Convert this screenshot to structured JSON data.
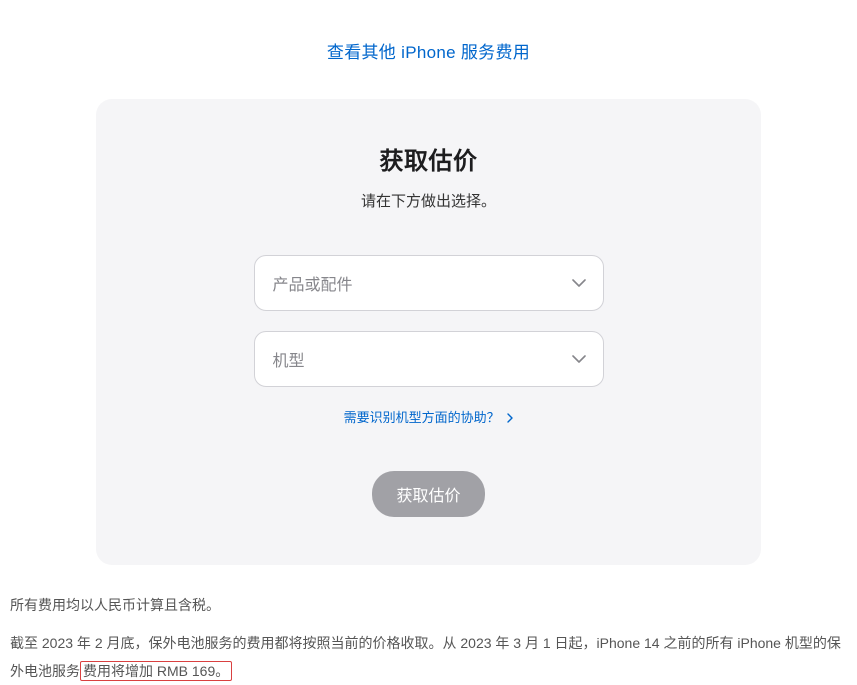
{
  "top_link": {
    "label": "查看其他 iPhone 服务费用"
  },
  "card": {
    "title": "获取估价",
    "subtitle": "请在下方做出选择。",
    "product_select": {
      "placeholder": "产品或配件"
    },
    "model_select": {
      "placeholder": "机型"
    },
    "help_link": {
      "label": "需要识别机型方面的协助？"
    },
    "submit_button": {
      "label": "获取估价"
    }
  },
  "footer": {
    "line1": "所有费用均以人民币计算且含税。",
    "line2_part1": "截至 2023 年 2 月底，保外电池服务的费用都将按照当前的价格收取。从 2023 年 3 月 1 日起，iPhone 14 之前的所有 iPhone 机型的保外电池服务",
    "line2_highlight": "费用将增加 RMB 169。"
  }
}
